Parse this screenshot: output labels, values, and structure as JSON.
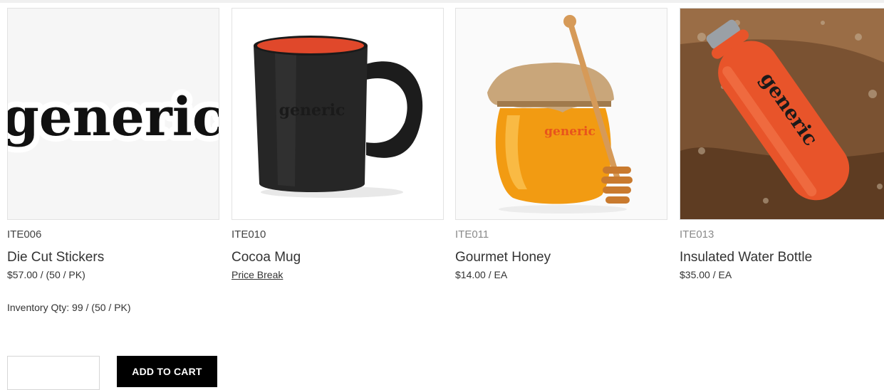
{
  "products": [
    {
      "sku": "ITE006",
      "name": "Die Cut Stickers",
      "price": "$57.00 / (50 / PK)",
      "image": "generic-sticker-image"
    },
    {
      "sku": "ITE010",
      "name": "Cocoa Mug",
      "price_link": "Price Break",
      "image": "black-mug-image"
    },
    {
      "sku": "ITE011",
      "name": "Gourmet Honey",
      "price": "$14.00 / EA",
      "image": "honey-jar-image"
    },
    {
      "sku": "ITE013",
      "name": "Insulated Water Bottle",
      "price": "$35.00 / EA",
      "image": "orange-bottle-image"
    }
  ],
  "inventory": {
    "label": "Inventory Qty:",
    "value": "99",
    "unit": "/ (50 / PK)"
  },
  "cart": {
    "qty_value": "",
    "button_label": "ADD TO CART"
  },
  "brand_text": "generic",
  "colors": {
    "button_bg": "#000000",
    "bottle": "#e8542a",
    "honey": "#f29b12"
  }
}
